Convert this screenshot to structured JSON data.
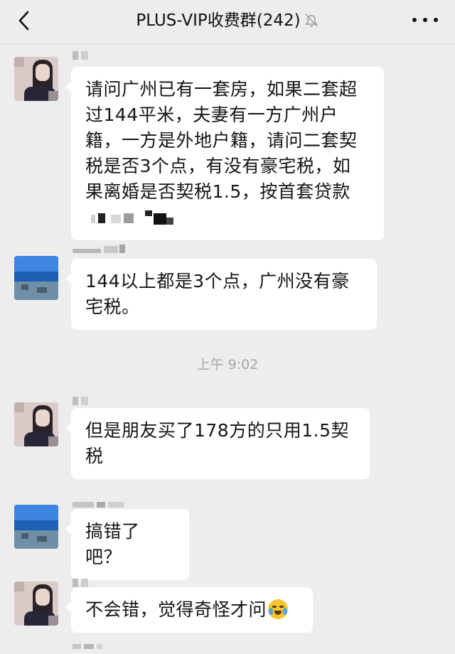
{
  "header": {
    "title": "PLUS-VIP收费群(242)",
    "back_icon": "chevron-left-icon",
    "mute_icon": "bell-muted-icon",
    "more_icon": "ellipsis-icon"
  },
  "messages": [
    {
      "sender": "member-1",
      "text_lines": [
        "请问广州已有一套房，如果二套超",
        "过144平米，夫妻有一方广州户",
        "籍，一方是外地户籍，请问二套契",
        "税是否3个点，有没有豪宅税，如",
        "果离婚是否契税1.5，按首套贷款"
      ]
    },
    {
      "sender": "member-2",
      "text_lines": [
        "144以上都是3个点，广州没有豪",
        "宅税。"
      ]
    },
    {
      "sender": "member-1",
      "text_lines": [
        "但是朋友买了178方的只用1.5契",
        "税"
      ]
    },
    {
      "sender": "member-2",
      "text_lines": [
        "搞错了吧？"
      ]
    },
    {
      "sender": "member-1",
      "text_lines": [
        "不会错，觉得奇怪才问"
      ],
      "trailing_emoji": "crying-laughing-emoji"
    }
  ],
  "timestamp": "上午 9:02"
}
